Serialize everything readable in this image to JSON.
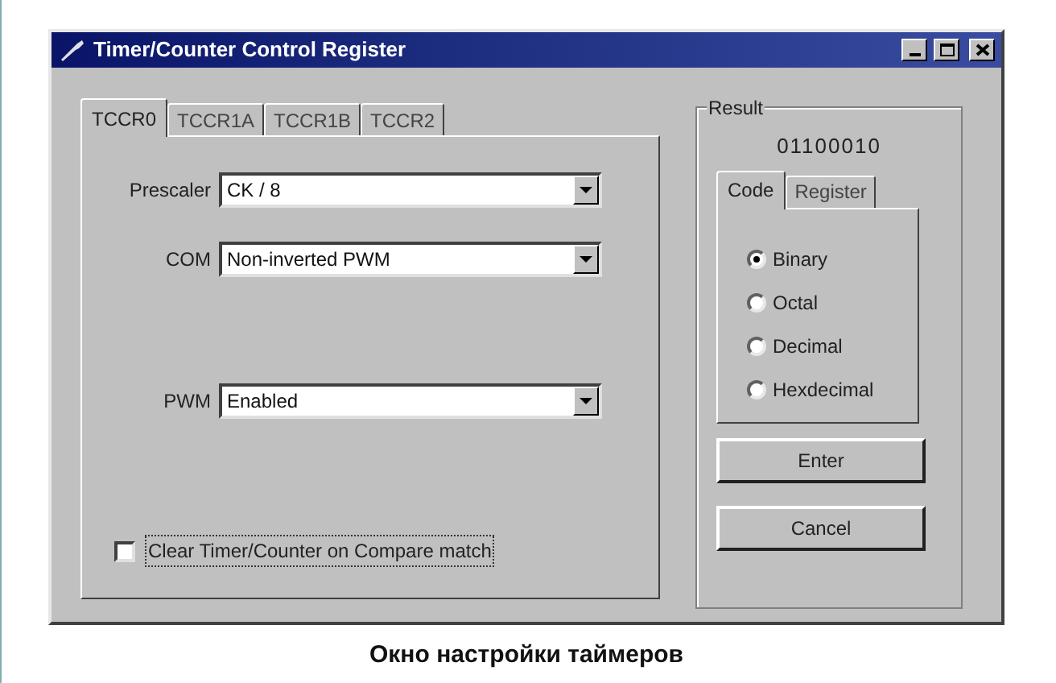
{
  "window": {
    "title": "Timer/Counter Control Register"
  },
  "tabs": [
    {
      "label": "TCCR0",
      "selected": true
    },
    {
      "label": "TCCR1A",
      "selected": false
    },
    {
      "label": "TCCR1B",
      "selected": false
    },
    {
      "label": "TCCR2",
      "selected": false
    }
  ],
  "fields": [
    {
      "label": "Prescaler",
      "value": "CK / 8"
    },
    {
      "label": "COM",
      "value": "Non-inverted PWM"
    },
    {
      "label": "PWM",
      "value": "Enabled"
    }
  ],
  "clear_on_match": {
    "label": "Clear Timer/Counter on Compare match",
    "checked": false
  },
  "result": {
    "title": "Result",
    "value": "01100010",
    "tabs": [
      {
        "label": "Code",
        "selected": true
      },
      {
        "label": "Register",
        "selected": false
      }
    ],
    "radios": [
      {
        "label": "Binary",
        "selected": true
      },
      {
        "label": "Octal",
        "selected": false
      },
      {
        "label": "Decimal",
        "selected": false
      },
      {
        "label": "Hexdecimal",
        "selected": false
      }
    ]
  },
  "buttons": [
    "Enter",
    "Cancel"
  ],
  "caption": "Окно настройки таймеров"
}
